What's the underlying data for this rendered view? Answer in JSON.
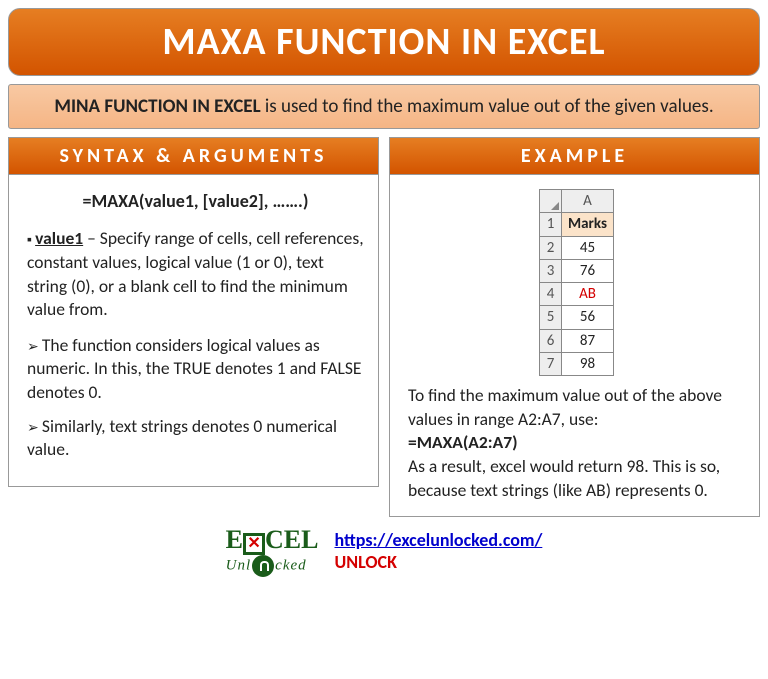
{
  "title": "MAXA FUNCTION IN EXCEL",
  "intro": {
    "strong": "MINA FUNCTION IN EXCEL",
    "rest": " is used to find the maximum value out of the given values."
  },
  "syntax": {
    "header": "SYNTAX & ARGUMENTS",
    "formula": "=MAXA(value1, [value2], …….)",
    "arg_name": "value1",
    "arg_desc": " – Specify range of cells, cell references, constant values, logical value (1 or 0), text string (0), or a blank cell to find the minimum value from.",
    "notes": [
      "The function considers logical values as numeric. In this, the TRUE denotes 1 and FALSE denotes 0.",
      "Similarly, text strings denotes 0 numerical value."
    ]
  },
  "example": {
    "header": "EXAMPLE",
    "col_label": "A",
    "rows": [
      {
        "n": "1",
        "v": "Marks",
        "hdr": true
      },
      {
        "n": "2",
        "v": "45"
      },
      {
        "n": "3",
        "v": "76"
      },
      {
        "n": "4",
        "v": "AB",
        "red": true
      },
      {
        "n": "5",
        "v": "56"
      },
      {
        "n": "6",
        "v": "87"
      },
      {
        "n": "7",
        "v": "98"
      }
    ],
    "text1": "To find the maximum value out of the above values in range A2:A7, use:",
    "formula": "=MAXA(A2:A7)",
    "text2": "As a result, excel would return 98. This is so, because text strings (like AB) represents 0."
  },
  "footer": {
    "logo_part1": "E",
    "logo_part2": "CEL",
    "logo_sub": "Unl   cked",
    "url": "https://excelunlocked.com/",
    "tag": "UNLOCK"
  }
}
